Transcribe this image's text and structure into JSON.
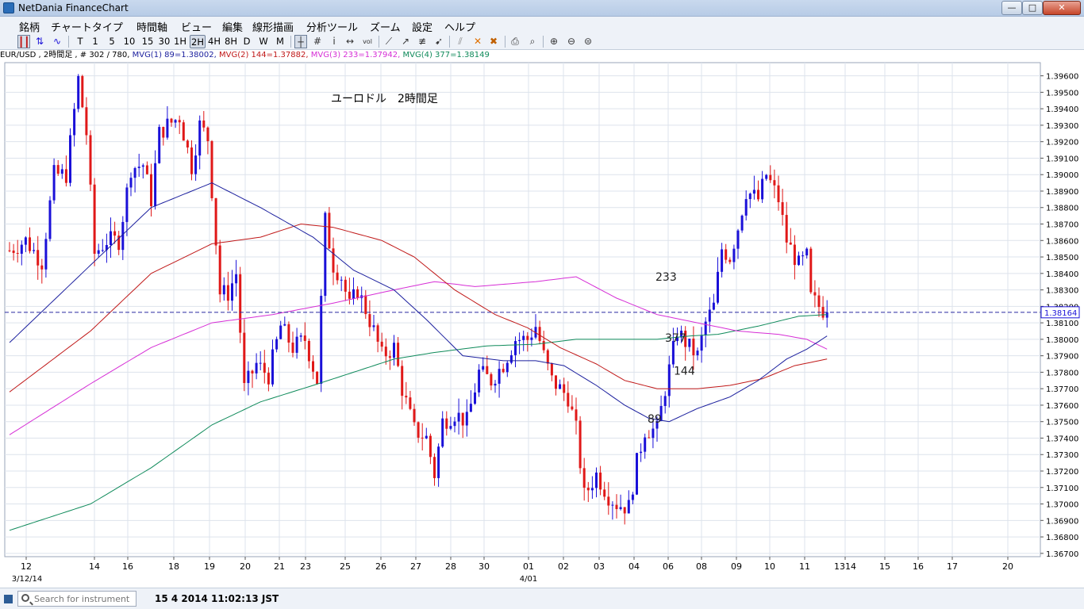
{
  "window": {
    "title": "NetDania FinanceChart",
    "min_label": "—",
    "max_label": "□",
    "close_label": "✕"
  },
  "menu": [
    "銘柄",
    "チャートタイプ",
    "時間軸",
    "ビュー",
    "編集",
    "線形描画",
    "分析ツール",
    "ズーム",
    "設定",
    "ヘルプ"
  ],
  "toolbar": {
    "timeframes": [
      "T",
      "1",
      "5",
      "10",
      "15",
      "30",
      "1H",
      "2H",
      "4H",
      "8H",
      "D",
      "W",
      "M"
    ],
    "active_timeframe": "2H",
    "icons": [
      "bar-chart-icon",
      "candlestick-icon",
      "line-chart-icon",
      "crosshair-icon",
      "grid-icon",
      "info-icon",
      "pan-icon",
      "volume-icon",
      "trendline-icon",
      "arrow-line-icon",
      "fibonacci-icon",
      "pointer-icon",
      "draw-lines-icon",
      "delete-icon",
      "delete-all-icon",
      "print-icon",
      "print-preview-icon",
      "zoom-in-icon",
      "zoom-out-icon",
      "zoom-fit-icon",
      "panel-toggle-icon"
    ]
  },
  "legend": {
    "symbol": "EUR/USD , 2時間足 , # 302 / 780,",
    "mvg1": "MVG(1) 89=1.38002,",
    "mvg2": "MVG(2) 144=1.37882,",
    "mvg3": "MVG(3) 233=1.37942,",
    "mvg4": "MVG(4) 377=1.38149"
  },
  "colors": {
    "up": "#1a10d8",
    "down": "#e01818",
    "ma89": "#1b1f9e",
    "ma144": "#c01818",
    "ma233": "#d62ed6",
    "ma377": "#0e8a5a",
    "current_line": "#2a2aa0"
  },
  "status": {
    "search_placeholder": "Search for instrument",
    "clock": "15 4 2014 11:02:13 JST"
  },
  "chart_data": {
    "type": "candlestick",
    "title": "ユーロドル　2時間足",
    "ylim": [
      1.3668,
      1.3968
    ],
    "y_ticks": [
      1.367,
      1.368,
      1.369,
      1.37,
      1.371,
      1.372,
      1.373,
      1.374,
      1.375,
      1.376,
      1.377,
      1.378,
      1.379,
      1.38,
      1.381,
      1.382,
      1.383,
      1.384,
      1.385,
      1.386,
      1.387,
      1.388,
      1.389,
      1.39,
      1.391,
      1.392,
      1.393,
      1.394,
      1.395,
      1.396
    ],
    "current_price": 1.38164,
    "x_labels": [
      "12",
      "14",
      "16",
      "18",
      "19",
      "20",
      "21",
      "23",
      "25",
      "26",
      "27",
      "28",
      "30",
      "01",
      "02",
      "03",
      "04",
      "06",
      "08",
      "09",
      "10",
      "11",
      "1314",
      "15",
      "16",
      "17",
      "20"
    ],
    "x_sub_labels": [
      "3/12/14",
      "4/01"
    ],
    "grid": true,
    "ma_labels": [
      "233",
      "377",
      "144",
      "89"
    ],
    "close_path": [
      [
        0,
        1.3854
      ],
      [
        4,
        1.386
      ],
      [
        8,
        1.3847
      ],
      [
        11,
        1.39
      ],
      [
        14,
        1.39
      ],
      [
        17,
        1.3958
      ],
      [
        19,
        1.3925
      ],
      [
        21,
        1.3852
      ],
      [
        24,
        1.386
      ],
      [
        27,
        1.386
      ],
      [
        30,
        1.3904
      ],
      [
        33,
        1.3906
      ],
      [
        35,
        1.3885
      ],
      [
        37,
        1.3925
      ],
      [
        39,
        1.393
      ],
      [
        42,
        1.3935
      ],
      [
        45,
        1.3905
      ],
      [
        47,
        1.393
      ],
      [
        49,
        1.3922
      ],
      [
        52,
        1.3828
      ],
      [
        54,
        1.3828
      ],
      [
        56,
        1.384
      ],
      [
        58,
        1.377
      ],
      [
        61,
        1.3785
      ],
      [
        64,
        1.3778
      ],
      [
        67,
        1.3808
      ],
      [
        70,
        1.3795
      ],
      [
        73,
        1.38
      ],
      [
        76,
        1.3775
      ],
      [
        78,
        1.3872
      ],
      [
        80,
        1.3845
      ],
      [
        82,
        1.3838
      ],
      [
        84,
        1.382
      ],
      [
        86,
        1.383
      ],
      [
        88,
        1.3818
      ],
      [
        90,
        1.3805
      ],
      [
        92,
        1.379
      ],
      [
        95,
        1.3795
      ],
      [
        97,
        1.377
      ],
      [
        100,
        1.3745
      ],
      [
        103,
        1.374
      ],
      [
        105,
        1.3718
      ],
      [
        107,
        1.375
      ],
      [
        110,
        1.3755
      ],
      [
        113,
        1.375
      ],
      [
        116,
        1.378
      ],
      [
        119,
        1.3775
      ],
      [
        122,
        1.3785
      ],
      [
        125,
        1.38
      ],
      [
        128,
        1.38
      ],
      [
        130,
        1.3808
      ],
      [
        132,
        1.379
      ],
      [
        134,
        1.3775
      ],
      [
        136,
        1.377
      ],
      [
        138,
        1.3765
      ],
      [
        140,
        1.3745
      ],
      [
        142,
        1.3705
      ],
      [
        145,
        1.3718
      ],
      [
        148,
        1.3705
      ],
      [
        150,
        1.37
      ],
      [
        153,
        1.3698
      ],
      [
        155,
        1.3725
      ],
      [
        157,
        1.3745
      ],
      [
        160,
        1.3745
      ],
      [
        162,
        1.377
      ],
      [
        165,
        1.3805
      ],
      [
        168,
        1.3795
      ],
      [
        170,
        1.379
      ],
      [
        172,
        1.381
      ],
      [
        174,
        1.382
      ],
      [
        176,
        1.3855
      ],
      [
        178,
        1.385
      ],
      [
        180,
        1.3868
      ],
      [
        182,
        1.389
      ],
      [
        185,
        1.3885
      ],
      [
        187,
        1.39
      ],
      [
        190,
        1.3885
      ],
      [
        192,
        1.386
      ],
      [
        195,
        1.3845
      ],
      [
        197,
        1.385
      ],
      [
        198,
        1.3825
      ],
      [
        200,
        1.382
      ],
      [
        202,
        1.3816
      ]
    ],
    "ma89": [
      [
        0,
        1.3798
      ],
      [
        20,
        1.3845
      ],
      [
        35,
        1.388
      ],
      [
        50,
        1.3895
      ],
      [
        62,
        1.388
      ],
      [
        75,
        1.3862
      ],
      [
        85,
        1.3842
      ],
      [
        95,
        1.383
      ],
      [
        103,
        1.3812
      ],
      [
        112,
        1.379
      ],
      [
        122,
        1.3787
      ],
      [
        130,
        1.3787
      ],
      [
        137,
        1.3784
      ],
      [
        145,
        1.3772
      ],
      [
        152,
        1.376
      ],
      [
        158,
        1.3752
      ],
      [
        163,
        1.375
      ],
      [
        170,
        1.3758
      ],
      [
        178,
        1.3765
      ],
      [
        185,
        1.3775
      ],
      [
        192,
        1.3788
      ],
      [
        197,
        1.3794
      ],
      [
        202,
        1.3802
      ]
    ],
    "ma144": [
      [
        0,
        1.3768
      ],
      [
        20,
        1.3805
      ],
      [
        35,
        1.384
      ],
      [
        50,
        1.3858
      ],
      [
        62,
        1.3862
      ],
      [
        72,
        1.387
      ],
      [
        80,
        1.3868
      ],
      [
        92,
        1.386
      ],
      [
        100,
        1.385
      ],
      [
        110,
        1.383
      ],
      [
        120,
        1.3815
      ],
      [
        128,
        1.3807
      ],
      [
        136,
        1.3795
      ],
      [
        145,
        1.3785
      ],
      [
        152,
        1.3775
      ],
      [
        160,
        1.377
      ],
      [
        170,
        1.377
      ],
      [
        178,
        1.3772
      ],
      [
        186,
        1.3776
      ],
      [
        194,
        1.3784
      ],
      [
        202,
        1.3788
      ]
    ],
    "ma233": [
      [
        0,
        1.3742
      ],
      [
        20,
        1.3773
      ],
      [
        35,
        1.3795
      ],
      [
        50,
        1.381
      ],
      [
        65,
        1.3815
      ],
      [
        80,
        1.3822
      ],
      [
        95,
        1.383
      ],
      [
        105,
        1.3835
      ],
      [
        115,
        1.3832
      ],
      [
        130,
        1.3835
      ],
      [
        140,
        1.3838
      ],
      [
        150,
        1.3825
      ],
      [
        160,
        1.3815
      ],
      [
        170,
        1.381
      ],
      [
        180,
        1.3805
      ],
      [
        190,
        1.3803
      ],
      [
        197,
        1.38
      ],
      [
        202,
        1.3794
      ]
    ],
    "ma377": [
      [
        0,
        1.3684
      ],
      [
        20,
        1.37
      ],
      [
        35,
        1.3722
      ],
      [
        50,
        1.3748
      ],
      [
        62,
        1.3762
      ],
      [
        75,
        1.3772
      ],
      [
        85,
        1.378
      ],
      [
        95,
        1.3788
      ],
      [
        105,
        1.3792
      ],
      [
        118,
        1.3796
      ],
      [
        130,
        1.3797
      ],
      [
        140,
        1.38
      ],
      [
        150,
        1.38
      ],
      [
        160,
        1.38
      ],
      [
        168,
        1.3802
      ],
      [
        175,
        1.3803
      ],
      [
        185,
        1.3808
      ],
      [
        195,
        1.3814
      ],
      [
        202,
        1.3815
      ]
    ]
  }
}
